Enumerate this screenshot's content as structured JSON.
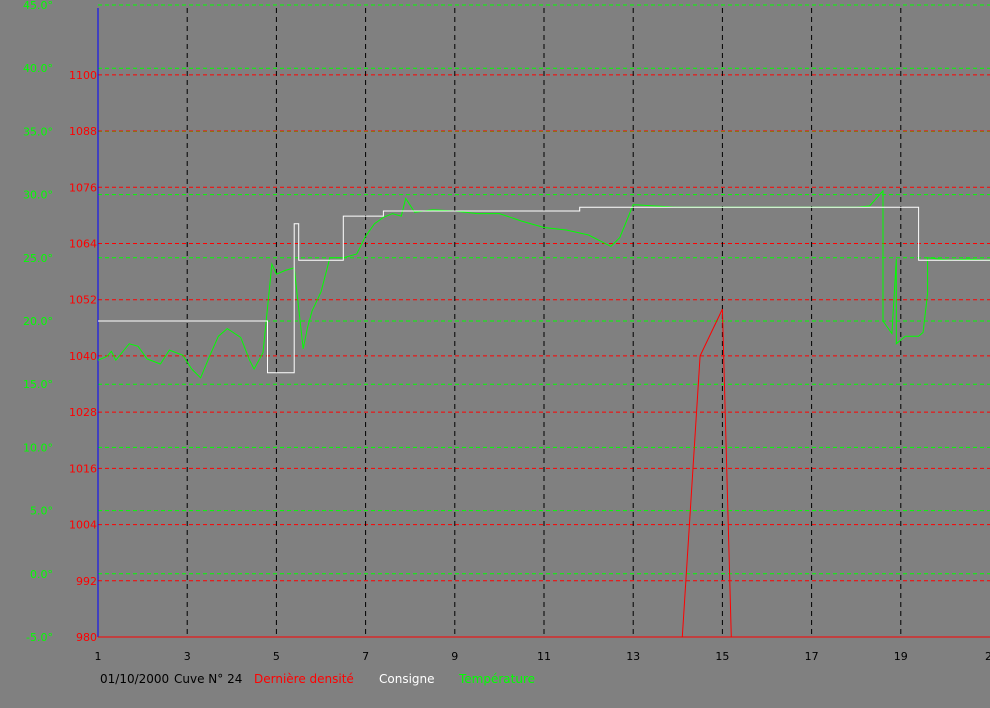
{
  "chart_data": {
    "type": "line",
    "caption": {
      "date": "01/10/2000",
      "tank": "Cuve N° 24",
      "density_label": "Dernière densité",
      "setpoint_label": "Consigne",
      "temperature_label": "Température"
    },
    "x_ticks": [
      "1",
      "3",
      "5",
      "7",
      "9",
      "11",
      "13",
      "15",
      "17",
      "19",
      "2"
    ],
    "x_range": [
      1,
      21
    ],
    "left_axis_temperature": {
      "range": [
        -5,
        45
      ],
      "ticks": [
        "-5.0°",
        "0.0°",
        "5.0°",
        "10.0°",
        "15.0°",
        "20.0°",
        "25.0°",
        "30.0°",
        "35.0°",
        "40.0°",
        "45.0°"
      ]
    },
    "left_axis_density": {
      "range": [
        980,
        1110
      ],
      "ticks": [
        "980",
        "992",
        "1004",
        "1016",
        "1028",
        "1040",
        "1052",
        "1064",
        "1076",
        "1088",
        "1100"
      ]
    },
    "grid": true,
    "colors": {
      "background": "#808080",
      "temperature": "#00ff00",
      "setpoint": "#ffffff",
      "density": "#ff0000",
      "x_grid": "#000000",
      "left_axis": "#0000ff",
      "caption_text": "#000000"
    },
    "series": [
      {
        "name": "Température",
        "axis": "temperature",
        "points": [
          [
            1.0,
            16.9
          ],
          [
            1.2,
            17.2
          ],
          [
            1.3,
            17.6
          ],
          [
            1.4,
            16.9
          ],
          [
            1.7,
            18.2
          ],
          [
            1.9,
            18.0
          ],
          [
            2.1,
            17.0
          ],
          [
            2.4,
            16.6
          ],
          [
            2.6,
            17.7
          ],
          [
            2.9,
            17.3
          ],
          [
            3.1,
            16.2
          ],
          [
            3.3,
            15.5
          ],
          [
            3.5,
            17.2
          ],
          [
            3.7,
            18.8
          ],
          [
            3.9,
            19.4
          ],
          [
            4.2,
            18.7
          ],
          [
            4.4,
            16.9
          ],
          [
            4.5,
            16.2
          ],
          [
            4.7,
            17.5
          ],
          [
            4.9,
            24.5
          ],
          [
            5.0,
            23.7
          ],
          [
            5.2,
            24.0
          ],
          [
            5.4,
            24.2
          ],
          [
            5.6,
            17.8
          ],
          [
            5.7,
            19.5
          ],
          [
            5.8,
            20.8
          ],
          [
            6.0,
            22.3
          ],
          [
            6.2,
            25.0
          ],
          [
            6.5,
            25.0
          ],
          [
            6.8,
            25.3
          ],
          [
            7.0,
            26.7
          ],
          [
            7.2,
            27.7
          ],
          [
            7.4,
            28.2
          ],
          [
            7.6,
            28.5
          ],
          [
            7.8,
            28.3
          ],
          [
            7.9,
            29.7
          ],
          [
            8.1,
            28.6
          ],
          [
            8.5,
            28.8
          ],
          [
            9.0,
            28.7
          ],
          [
            9.5,
            28.5
          ],
          [
            10.0,
            28.5
          ],
          [
            10.5,
            27.9
          ],
          [
            11.0,
            27.4
          ],
          [
            11.5,
            27.2
          ],
          [
            12.0,
            26.8
          ],
          [
            12.5,
            25.9
          ],
          [
            12.7,
            26.6
          ],
          [
            13.0,
            29.2
          ],
          [
            13.5,
            29.1
          ],
          [
            14.0,
            29.0
          ],
          [
            15.0,
            29.0
          ],
          [
            16.0,
            29.0
          ],
          [
            17.0,
            29.0
          ],
          [
            18.0,
            29.0
          ],
          [
            18.3,
            29.1
          ],
          [
            18.6,
            30.3
          ],
          [
            18.6,
            20.0
          ],
          [
            18.8,
            19.0
          ],
          [
            18.9,
            24.9
          ],
          [
            18.9,
            18.2
          ],
          [
            19.1,
            18.8
          ],
          [
            19.4,
            18.8
          ],
          [
            19.5,
            19.1
          ],
          [
            19.6,
            22.2
          ],
          [
            19.6,
            25.0
          ],
          [
            20.1,
            24.8
          ],
          [
            20.5,
            24.9
          ],
          [
            21.0,
            24.8
          ]
        ]
      },
      {
        "name": "Consigne",
        "axis": "temperature",
        "points": [
          [
            1.0,
            20.0
          ],
          [
            4.8,
            20.0
          ],
          [
            4.8,
            15.9
          ],
          [
            5.4,
            15.9
          ],
          [
            5.4,
            27.7
          ],
          [
            5.5,
            27.7
          ],
          [
            5.5,
            24.8
          ],
          [
            6.5,
            24.8
          ],
          [
            6.5,
            28.3
          ],
          [
            7.4,
            28.3
          ],
          [
            7.4,
            28.7
          ],
          [
            11.8,
            28.7
          ],
          [
            11.8,
            29.0
          ],
          [
            19.4,
            29.0
          ],
          [
            19.4,
            24.8
          ],
          [
            21.0,
            24.8
          ]
        ]
      },
      {
        "name": "Dernière densité",
        "axis": "density",
        "points": [
          [
            14.1,
            980
          ],
          [
            14.5,
            1040
          ],
          [
            15.0,
            1050
          ],
          [
            15.2,
            980
          ]
        ]
      }
    ]
  }
}
